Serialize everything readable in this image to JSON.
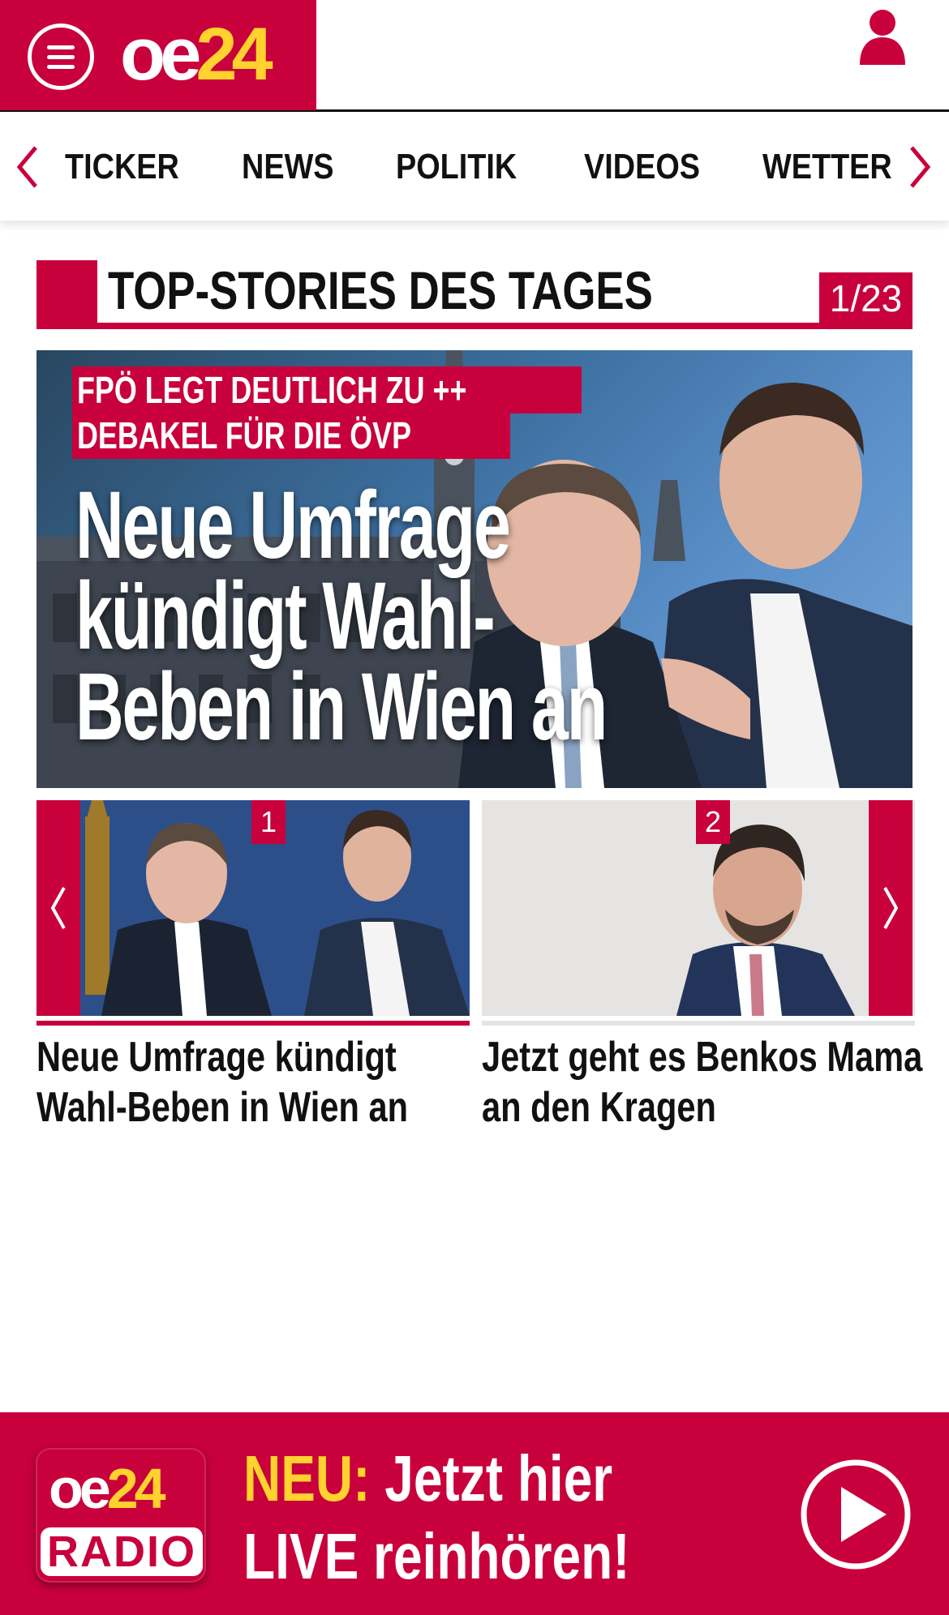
{
  "header": {
    "logo_oe": "oe",
    "logo_24": "24",
    "menu_icon": "hamburger-menu-icon",
    "user_icon": "user-icon"
  },
  "nav": {
    "items": [
      "TICKER",
      "NEWS",
      "POLITIK",
      "VIDEOS",
      "WETTER"
    ],
    "prev_icon": "chevron-left-icon",
    "next_icon": "chevron-right-icon"
  },
  "section": {
    "title": "TOP-STORIES DES TAGES",
    "counter": "1/23"
  },
  "hero": {
    "kicker_line1": "FPÖ LEGT DEUTLICH ZU ++",
    "kicker_line2": "DEBAKEL FÜR DIE ÖVP",
    "headline_line1": "Neue Umfrage",
    "headline_line2": "kündigt Wahl-",
    "headline_line3": "Beben in Wien an"
  },
  "cards": [
    {
      "number": "1",
      "title_line1": "Neue Umfrage kündigt",
      "title_line2": "Wahl-Beben in Wien an"
    },
    {
      "number": "2",
      "title_line1": "Jetzt geht es Benkos Mama",
      "title_line2": "an den Kragen"
    }
  ],
  "radio": {
    "logo_oe": "oe",
    "logo_24": "24",
    "logo_radio": "RADIO",
    "neu": "NEU:",
    "line1_rest": " Jetzt hier",
    "line2": "LIVE reinhören!",
    "play_icon": "play-icon"
  },
  "colors": {
    "brand_red": "#c8003c",
    "brand_yellow": "#ffd22e"
  }
}
